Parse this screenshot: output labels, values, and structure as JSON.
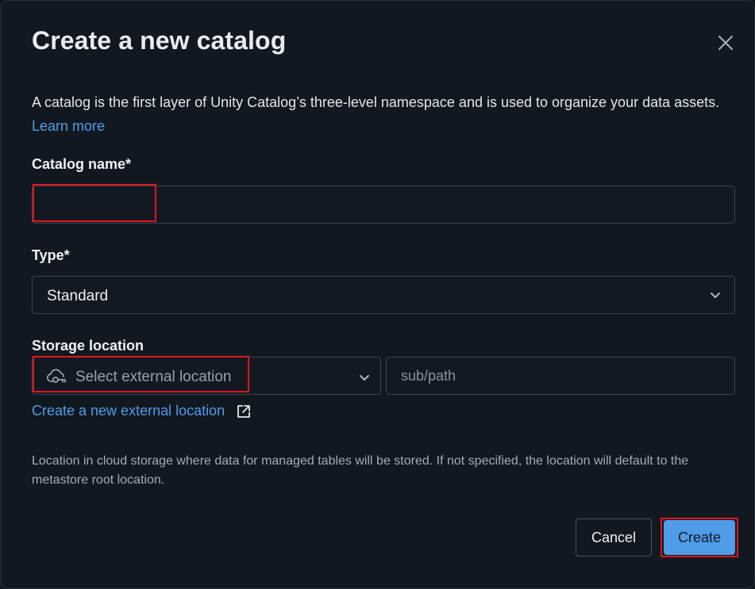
{
  "dialog": {
    "title": "Create a new catalog",
    "description": "A catalog is the first layer of Unity Catalog’s three-level namespace and is used to organize your data assets.",
    "learn_more": "Learn more"
  },
  "catalog_name": {
    "label": "Catalog name*",
    "value": "",
    "placeholder": ""
  },
  "type": {
    "label": "Type*",
    "selected": "Standard"
  },
  "storage": {
    "label": "Storage location",
    "location_placeholder": "Select external location",
    "subpath_placeholder": "sub/path",
    "create_link": "Create a new external location",
    "helper": "Location in cloud storage where data for managed tables will be stored. If not specified, the location will default to the metastore root location."
  },
  "buttons": {
    "cancel": "Cancel",
    "create": "Create"
  },
  "colors": {
    "background": "#121820",
    "accent": "#4f9ce8",
    "highlight": "#e0161f"
  },
  "icons": {
    "close": "close-icon",
    "chevron": "chevron-down-icon",
    "cloud_key": "cloud-key-icon",
    "external": "external-link-icon"
  }
}
